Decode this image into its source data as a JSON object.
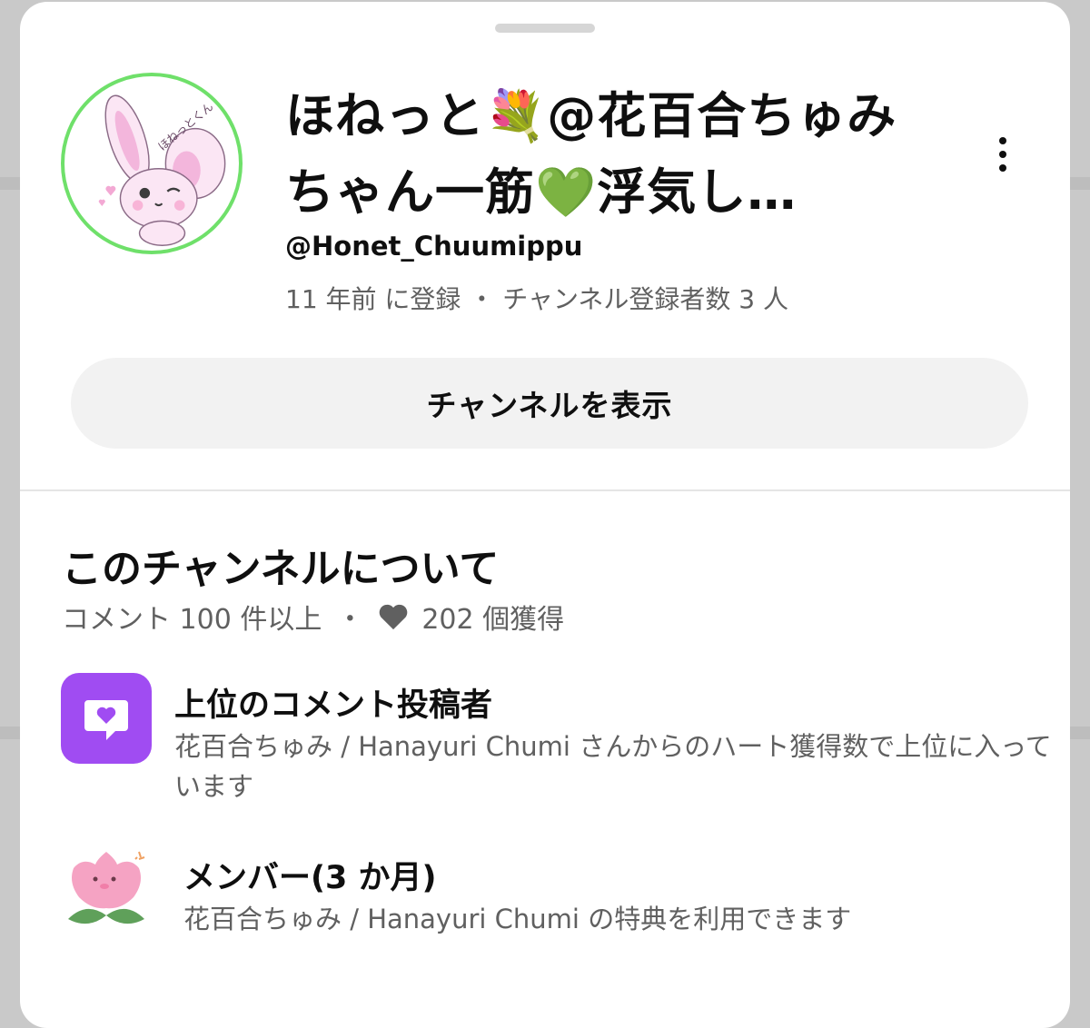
{
  "channel": {
    "name": "ほねっと💐@花百合ちゅみちゃん一筋💚浮気し…",
    "handle": "@Honet_Chuumippu",
    "meta": "11 年前 に登録 ・ チャンネル登録者数 3 人",
    "view_channel_label": "チャンネルを表示"
  },
  "about": {
    "title": "このチャンネルについて",
    "comments": "コメント 100 件以上",
    "separator": "・",
    "hearts": "202 個獲得"
  },
  "badges": [
    {
      "title": "上位のコメント投稿者",
      "description": "花百合ちゅみ / Hanayuri Chumi さんからのハート獲得数で上位に入っています",
      "icon": "heart-comment-icon",
      "color": "#a04cf2"
    },
    {
      "title": "メンバー(3 か月)",
      "description": "花百合ちゅみ / Hanayuri Chumi の特典を利用できます",
      "icon": "pink-flower-icon"
    }
  ],
  "colors": {
    "avatar_ring": "#6fe06a",
    "secondary_text": "#606060",
    "button_bg": "#f2f2f2"
  }
}
